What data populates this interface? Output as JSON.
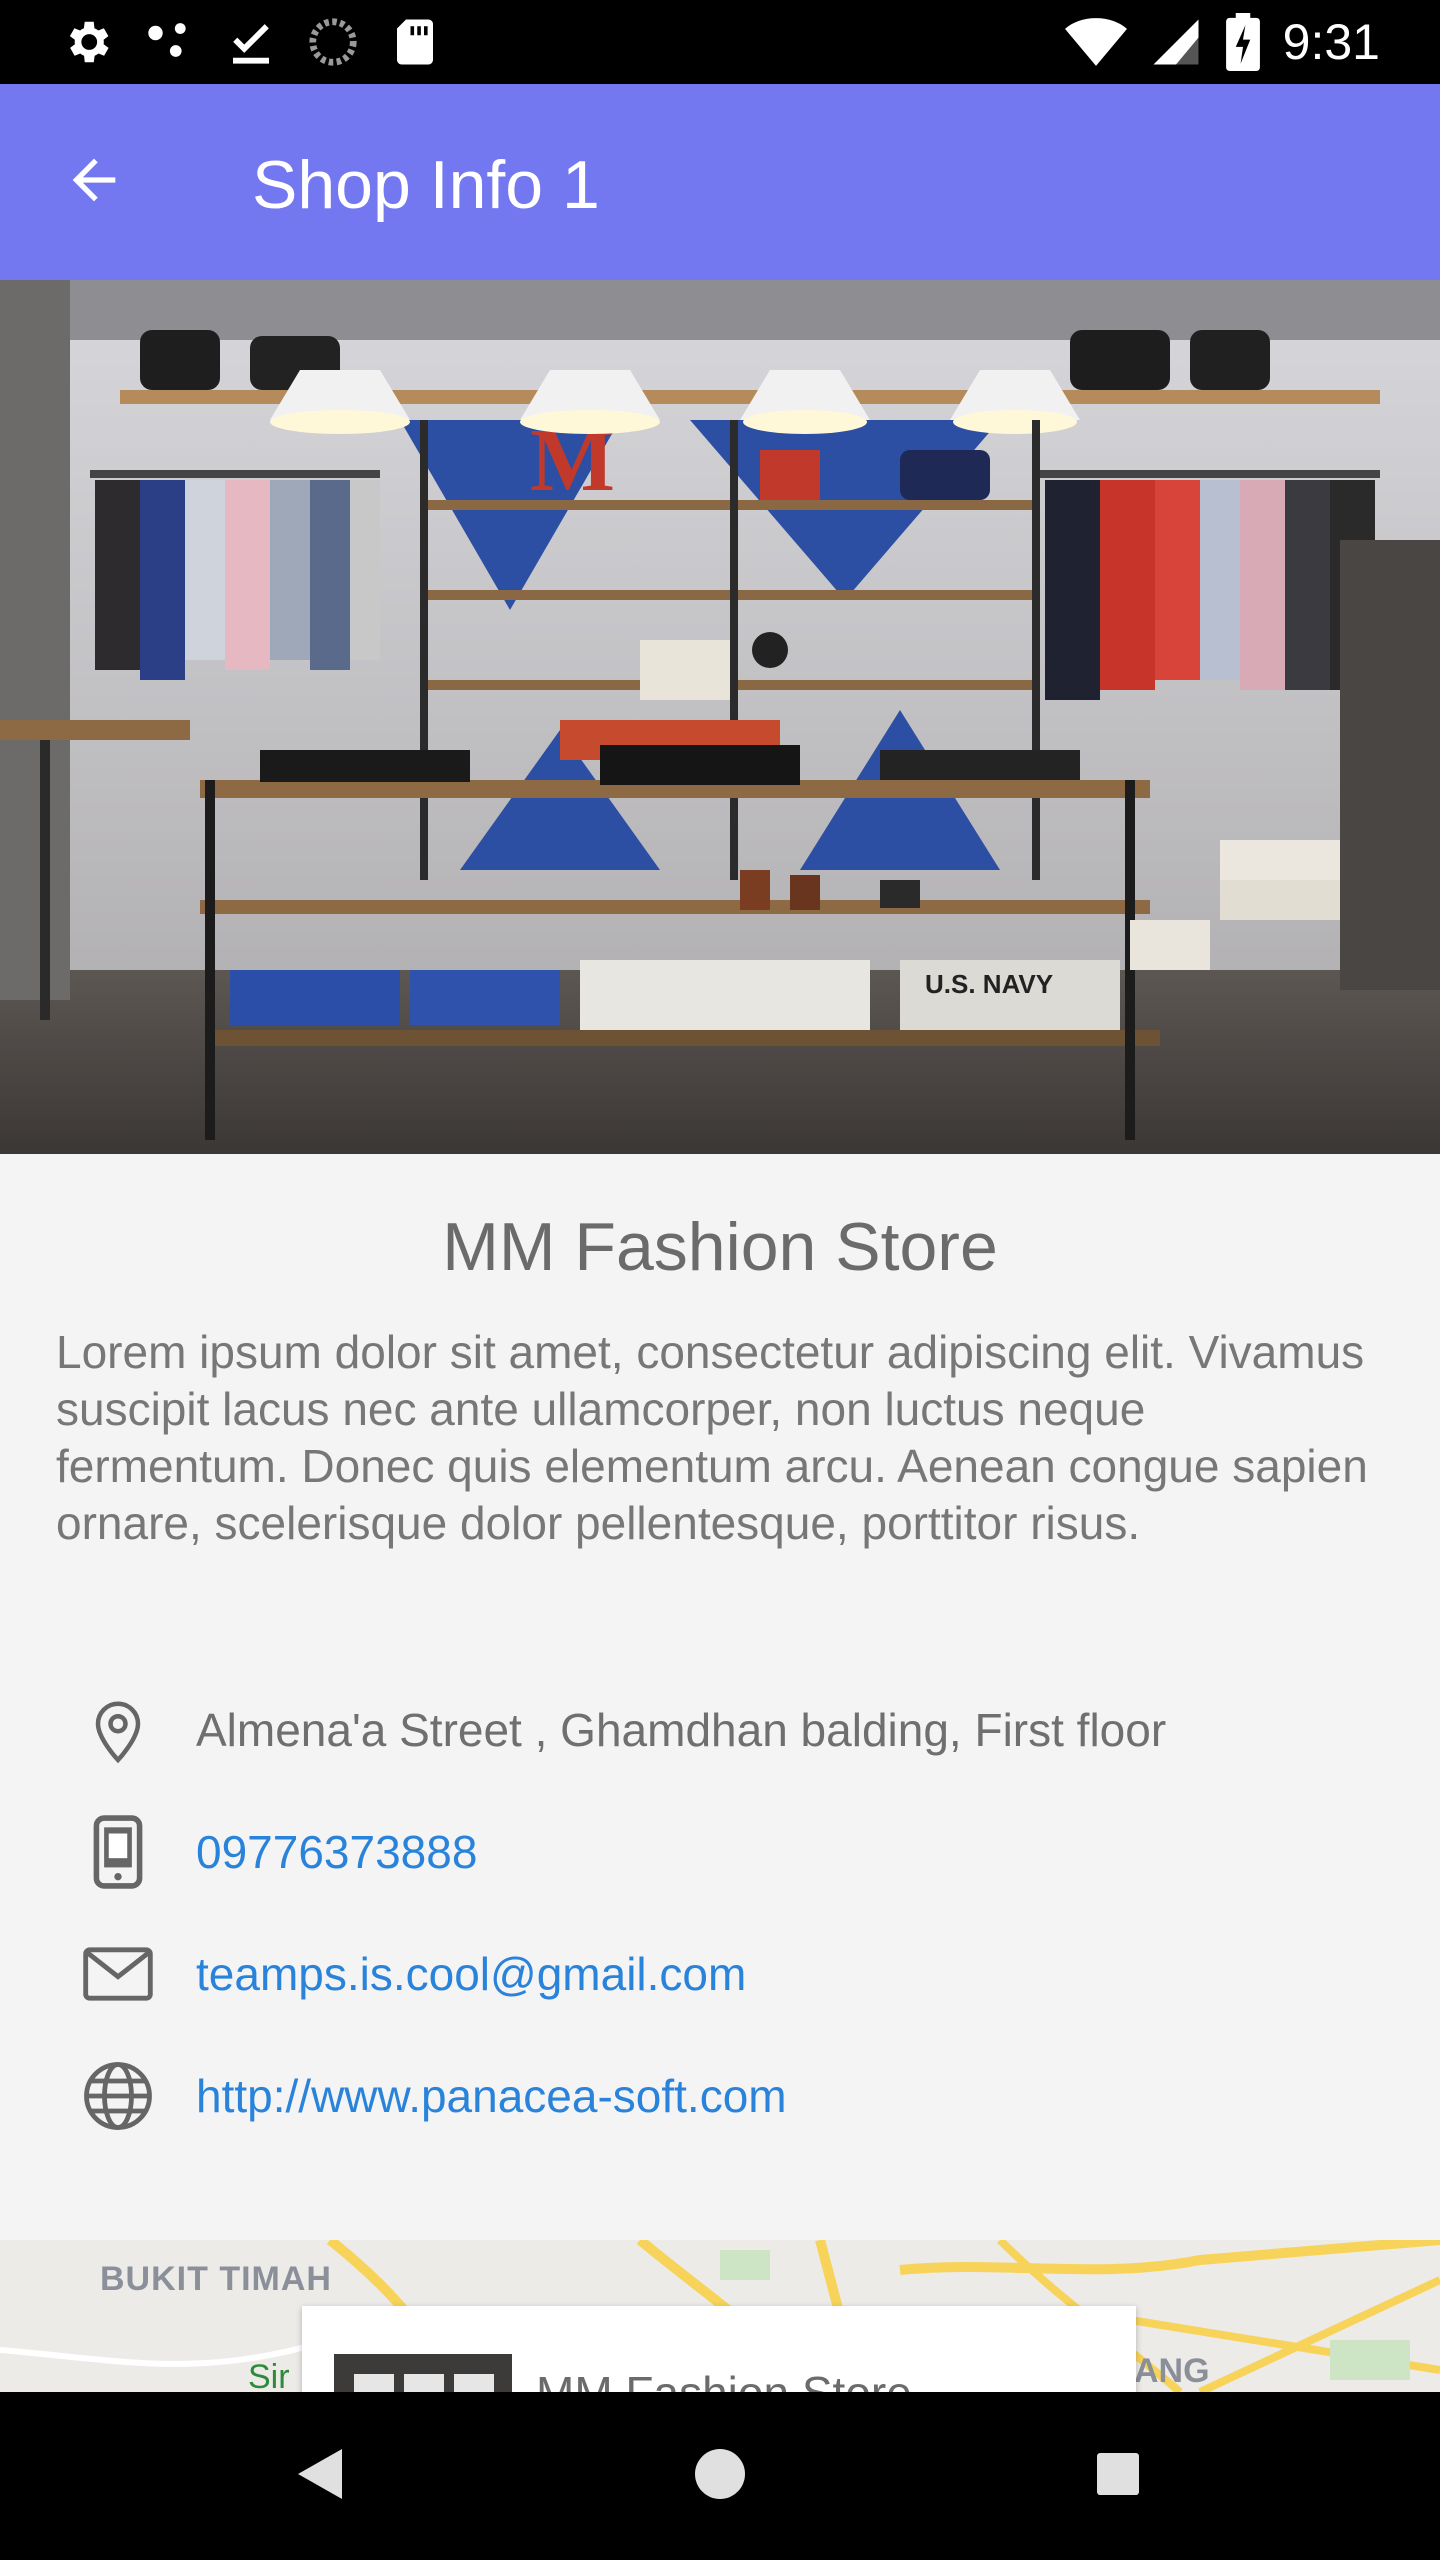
{
  "status_bar": {
    "time": "9:31",
    "left_icons": [
      "gear-icon",
      "share-dots-icon",
      "download-done-icon",
      "sync-spinner-icon",
      "sd-card-icon"
    ],
    "right_icons": [
      "wifi-icon",
      "signal-icon",
      "battery-charging-icon"
    ]
  },
  "app_bar": {
    "title": "Shop Info 1",
    "back_icon": "arrow-back-icon",
    "color": "#7378f1"
  },
  "hero": {
    "description_icon": "shop-interior-photo"
  },
  "shop": {
    "name": "MM Fashion Store",
    "description": "Lorem ipsum dolor sit amet, consectetur adipiscing elit. Vivamus suscipit lacus nec ante ullamcorper, non luctus neque fermentum. Donec quis elementum arcu. Aenean congue sapien ornare, scelerisque dolor pellentesque, porttitor risus.",
    "address": "Almena'a Street , Ghamdhan balding, First floor",
    "phone": "09776373888",
    "email": "teamps.is.cool@gmail.com",
    "website": "http://www.panacea-soft.com"
  },
  "map": {
    "label_area": "BUKIT TIMAH",
    "label_right": "ANG",
    "label_left": "Sir",
    "card_title": "MM Fashion Store"
  },
  "colors": {
    "link": "#2a83da",
    "text": "#6f6f6f",
    "background": "#f4f4f4"
  },
  "nav_bar": {
    "buttons": [
      "back-triangle-icon",
      "home-circle-icon",
      "recents-square-icon"
    ]
  }
}
